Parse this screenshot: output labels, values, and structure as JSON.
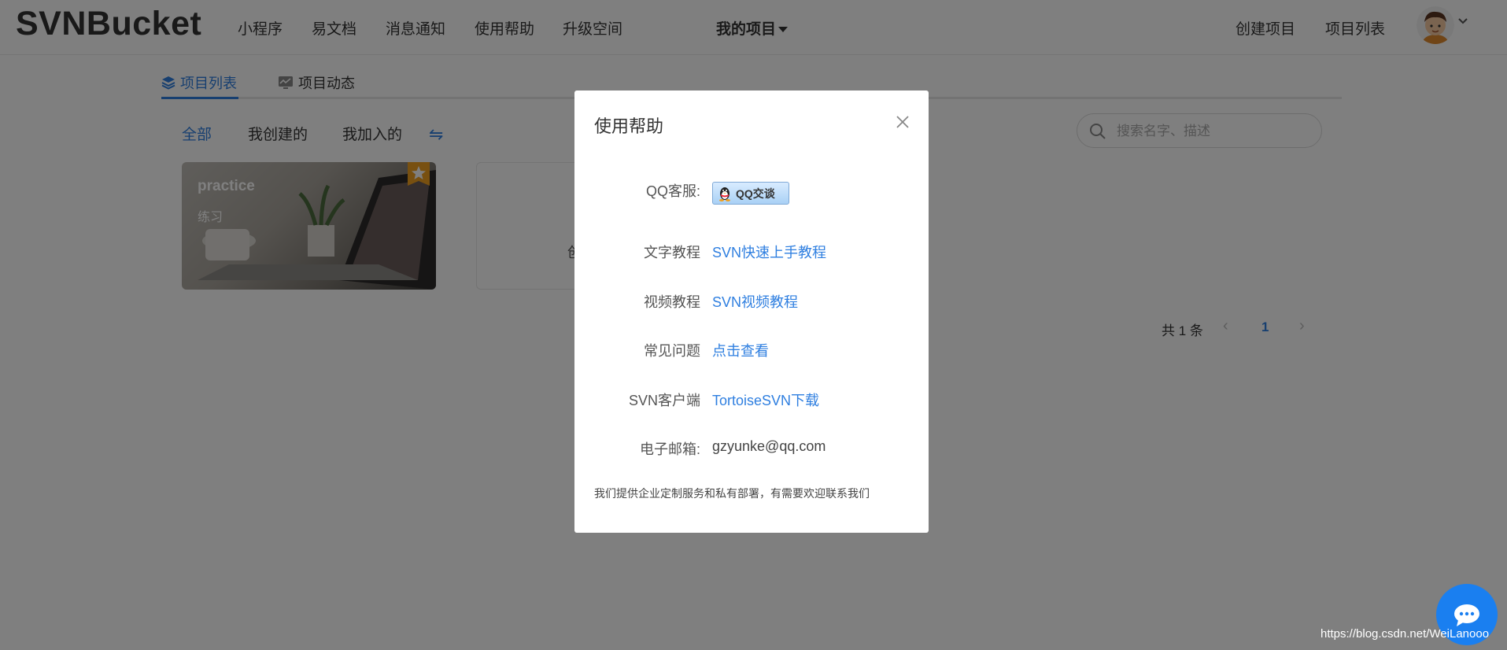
{
  "header": {
    "logo": "SVNBucket",
    "nav": [
      "小程序",
      "易文档",
      "消息通知",
      "使用帮助",
      "升级空间"
    ],
    "my_projects": "我的项目",
    "create_project": "创建项目",
    "project_list": "项目列表"
  },
  "tabs": {
    "list": "项目列表",
    "activity": "项目动态"
  },
  "filters": {
    "all": "全部",
    "created": "我创建的",
    "joined": "我加入的",
    "switch_icon": "⇋"
  },
  "search": {
    "placeholder": "搜索名字、描述"
  },
  "project_card": {
    "title": "practice",
    "desc": "练习"
  },
  "create_card": {
    "text": "创"
  },
  "pagination": {
    "total": "共 1 条",
    "prev": "‹",
    "page": "1",
    "next": "›"
  },
  "modal": {
    "title": "使用帮助",
    "rows": [
      {
        "label": "QQ客服:",
        "button": "QQ交谈"
      },
      {
        "label": "文字教程",
        "value": "SVN快速上手教程"
      },
      {
        "label": "视频教程",
        "value": "SVN视频教程"
      },
      {
        "label": "常见问题",
        "value": "点击查看"
      },
      {
        "label": "SVN客户端",
        "value": "TortoiseSVN下载"
      },
      {
        "label": "电子邮箱:",
        "value": "gzyunke@qq.com"
      }
    ],
    "note": "我们提供企业定制服务和私有部署，有需要欢迎联系我们"
  },
  "watermark": "https://blog.csdn.net/WeiLanooo",
  "colors": {
    "accent": "#2f7fe0",
    "fab": "#1a7ff0",
    "overlay": "rgba(0,0,0,0.5)"
  },
  "icons": [
    "layers-icon",
    "activity-icon",
    "switch-icon",
    "search-icon",
    "star-badge-icon",
    "close-icon",
    "qq-penguin-icon",
    "chat-icon",
    "chevron-down-icon"
  ]
}
